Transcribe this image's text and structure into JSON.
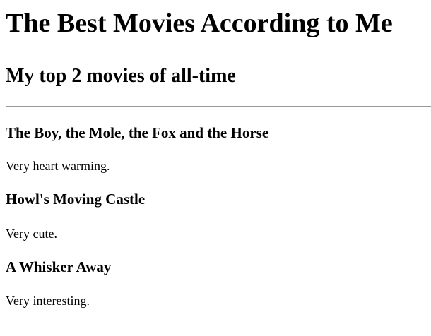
{
  "page": {
    "title": "The Best Movies According to Me",
    "subtitle": "My top 2 movies of all-time"
  },
  "movies": [
    {
      "title": "The Boy, the Mole, the Fox and the Horse",
      "description": "Very heart warming."
    },
    {
      "title": "Howl's Moving Castle",
      "description": "Very cute."
    },
    {
      "title": "A Whisker Away",
      "description": "Very interesting."
    }
  ]
}
